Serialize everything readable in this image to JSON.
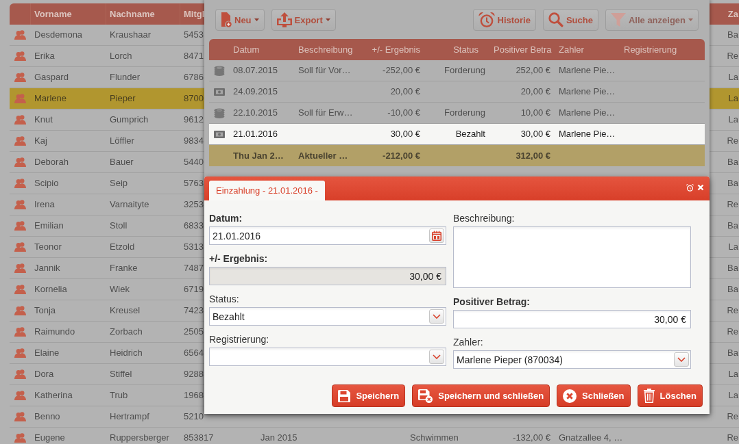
{
  "member_list": {
    "header": {
      "vorname": "Vorname",
      "nachname": "Nachname",
      "column_3": "Mitgl",
      "column_8": "Za"
    },
    "rows": [
      {
        "vorname": "Desdemona",
        "nachname": "Kraushaar",
        "column_3": "5453",
        "column_8": "Ba",
        "selected": false
      },
      {
        "vorname": "Erika",
        "nachname": "Lorch",
        "column_3": "8471",
        "column_8": "Re",
        "selected": false
      },
      {
        "vorname": "Gaspard",
        "nachname": "Flunder",
        "column_3": "6786",
        "column_8": "La",
        "selected": false
      },
      {
        "vorname": "Marlene",
        "nachname": "Pieper",
        "column_3": "8700",
        "column_8": "La",
        "selected": true
      },
      {
        "vorname": "Knut",
        "nachname": "Gumprich",
        "column_3": "9612",
        "column_8": "La",
        "selected": false
      },
      {
        "vorname": "Kaj",
        "nachname": "Löffler",
        "column_3": "9834",
        "column_8": "Re",
        "selected": false
      },
      {
        "vorname": "Deborah",
        "nachname": "Bauer",
        "column_3": "5440",
        "column_8": "Ba",
        "selected": false
      },
      {
        "vorname": "Scipio",
        "nachname": "Seip",
        "column_3": "5763",
        "column_8": "Ba",
        "selected": false
      },
      {
        "vorname": "Irena",
        "nachname": "Varnaityte",
        "column_3": "3253",
        "column_8": "Re",
        "selected": false
      },
      {
        "vorname": "Emilian",
        "nachname": "Stoll",
        "column_3": "6833",
        "column_8": "Ba",
        "selected": false
      },
      {
        "vorname": "Teonor",
        "nachname": "Etzold",
        "column_3": "5313",
        "column_8": "La",
        "selected": false
      },
      {
        "vorname": "Jannik",
        "nachname": "Franke",
        "column_3": "7487",
        "column_8": "Ba",
        "selected": false
      },
      {
        "vorname": "Kornelia",
        "nachname": "Wiek",
        "column_3": "6719",
        "column_8": "Ba",
        "selected": false
      },
      {
        "vorname": "Tonja",
        "nachname": "Kreusel",
        "column_3": "7423",
        "column_8": "Re",
        "selected": false
      },
      {
        "vorname": "Raimundo",
        "nachname": "Zorbach",
        "column_3": "2505",
        "column_8": "Re",
        "selected": false
      },
      {
        "vorname": "Elaine",
        "nachname": "Heidrich",
        "column_3": "6564",
        "column_8": "Ba",
        "selected": false
      },
      {
        "vorname": "Dora",
        "nachname": "Stiffel",
        "column_3": "9288",
        "column_8": "La",
        "selected": false
      },
      {
        "vorname": "Katherina",
        "nachname": "Trub",
        "column_3": "1968",
        "column_8": "La",
        "selected": false
      },
      {
        "vorname": "Benno",
        "nachname": "Hertrampf",
        "column_3": "5210",
        "column_8": "Re",
        "selected": false
      },
      {
        "vorname": "Eugene",
        "nachname": "Ruppersberger",
        "column_3": "853817",
        "column_4": "Jan 2015",
        "column_5": "Schwimmen",
        "column_6": "-132,00 €",
        "column_7": "Gnatzallee 4, …",
        "column_8": "Re",
        "selected": false
      }
    ]
  },
  "window": {
    "toolbar_left": [
      {
        "label": "Neu",
        "menu": true,
        "disabled": false
      },
      {
        "label": "Export",
        "menu": true,
        "disabled": false
      }
    ],
    "toolbar_right": [
      {
        "label": "Historie",
        "menu": false,
        "disabled": false
      },
      {
        "label": "Suche",
        "menu": false,
        "disabled": false
      },
      {
        "label": "Alle anzeigen",
        "menu": true,
        "disabled": true
      }
    ],
    "transactions": {
      "columns": [
        "Datum",
        "Beschreibung",
        "+/- Ergebnis",
        "Status",
        "Positiver Betra",
        "Zahler",
        "Registrierung"
      ],
      "rows": [
        {
          "kind": "coins",
          "datum": "08.07.2015",
          "beschreibung": "Soll für Vor…",
          "ergebnis": "-252,00 €",
          "status": "Forderung",
          "positiver_betrag": "252,00 €",
          "zahler": "Marlene Pie…",
          "selected": false
        },
        {
          "kind": "banknote",
          "datum": "24.09.2015",
          "ergebnis": "20,00 €",
          "positiver_betrag": "20,00 €",
          "zahler": "Marlene Pie…",
          "selected": false
        },
        {
          "kind": "coins",
          "datum": "22.10.2015",
          "beschreibung": "Soll für Erw…",
          "ergebnis": "-10,00 €",
          "status": "Forderung",
          "positiver_betrag": "10,00 €",
          "zahler": "Marlene Pie…",
          "selected": false
        },
        {
          "kind": "banknote",
          "datum": "21.01.2016",
          "ergebnis": "30,00 €",
          "status": "Bezahlt",
          "positiver_betrag": "30,00 €",
          "zahler": "Marlene Pie…",
          "selected": true
        }
      ],
      "summary": {
        "datum": "Thu Jan 2…",
        "beschreibung": "Aktueller …",
        "ergebnis": "-212,00 €",
        "positiver_betrag": "312,00 €"
      }
    }
  },
  "dialog": {
    "tab": {
      "label": "Einzahlung - 21.01.2016 -",
      "selected": true
    },
    "fields_left": [
      {
        "kind": "date",
        "label": "Datum:",
        "required": true,
        "value": "21.01.2016"
      },
      {
        "kind": "amount",
        "label": "+/- Ergebnis:",
        "required": true,
        "readonly": true,
        "value": "30,00 €"
      },
      {
        "kind": "select",
        "label": "Status:",
        "required": false,
        "value": "Bezahlt"
      },
      {
        "kind": "select",
        "label": "Registrierung:",
        "required": false
      }
    ],
    "fields_right": [
      {
        "kind": "textarea",
        "label": "Beschreibung:",
        "required": false
      },
      {
        "kind": "amount",
        "label": "Positiver Betrag:",
        "required": true,
        "readonly": false,
        "value": "30,00 €"
      },
      {
        "kind": "select",
        "label": "Zahler:",
        "required": false,
        "value": "Marlene Pieper (870034)"
      }
    ],
    "buttons": [
      {
        "label": "Speichern"
      },
      {
        "label": "Speichern und schließen"
      },
      {
        "label": "Schließen"
      },
      {
        "label": "Löschen"
      }
    ]
  }
}
